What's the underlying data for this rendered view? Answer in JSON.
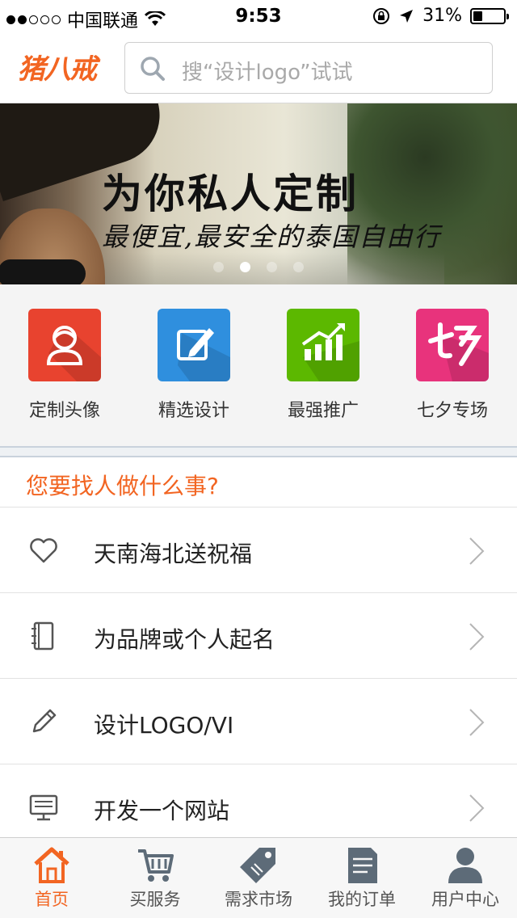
{
  "status_bar": {
    "carrier": "中国联通",
    "time": "9:53",
    "battery": "31%",
    "battery_level": 0.31
  },
  "header": {
    "logo": "猪八戒",
    "search_placeholder": "搜“设计logo”试试",
    "search_icon": "search-icon"
  },
  "banner": {
    "title": "为你私人定制",
    "subtitle": "最便宜,最安全的泰国自由行",
    "pages": 4,
    "active_page": 2
  },
  "quick_actions": [
    {
      "label": "定制头像",
      "icon": "avatar-icon",
      "color": "#e8432f"
    },
    {
      "label": "精选设计",
      "icon": "edit-icon",
      "color": "#2f8fde"
    },
    {
      "label": "最强推广",
      "icon": "chart-icon",
      "color": "#5cb800"
    },
    {
      "label": "七夕专场",
      "icon": "qixi-icon",
      "color": "#e8337c"
    }
  ],
  "section": {
    "title": "您要找人做什么事?"
  },
  "list": [
    {
      "label": "天南海北送祝福",
      "icon": "heart-icon"
    },
    {
      "label": "为品牌或个人起名",
      "icon": "notebook-icon"
    },
    {
      "label": "设计LOGO/VI",
      "icon": "pencil-icon"
    },
    {
      "label": "开发一个网站",
      "icon": "monitor-icon"
    }
  ],
  "tabbar": [
    {
      "label": "首页",
      "icon": "home-icon",
      "active": true
    },
    {
      "label": "买服务",
      "icon": "cart-icon",
      "active": false
    },
    {
      "label": "需求市场",
      "icon": "tag-icon",
      "active": false
    },
    {
      "label": "我的订单",
      "icon": "document-icon",
      "active": false
    },
    {
      "label": "用户中心",
      "icon": "user-icon",
      "active": false
    }
  ],
  "colors": {
    "accent": "#f26522",
    "tab_inactive": "#5d6b78"
  }
}
